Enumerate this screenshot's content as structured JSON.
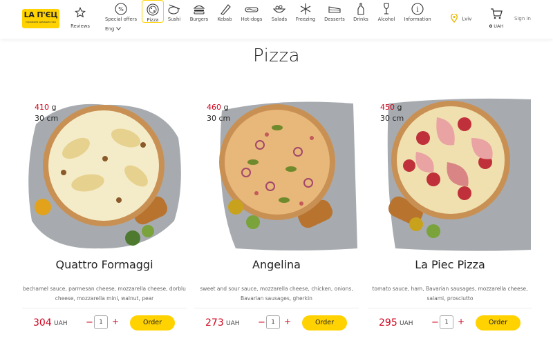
{
  "brand": {
    "logo_text": "LA П'ЄЦ",
    "logo_tagline": "справжня домашня їжа",
    "color": "#ffd200"
  },
  "header": {
    "reviews_label": "Reviews",
    "nav": [
      {
        "label": "Special offers",
        "icon": "percent-icon"
      },
      {
        "label": "Pizza",
        "icon": "pizza-icon",
        "active": true
      },
      {
        "label": "Sushi",
        "icon": "sushi-icon"
      },
      {
        "label": "Burgers",
        "icon": "burger-icon"
      },
      {
        "label": "Kebab",
        "icon": "kebab-icon"
      },
      {
        "label": "Hot-dogs",
        "icon": "hotdog-icon"
      },
      {
        "label": "Salads",
        "icon": "salad-icon"
      },
      {
        "label": "Freezing",
        "icon": "snowflake-icon"
      },
      {
        "label": "Desserts",
        "icon": "cake-icon"
      },
      {
        "label": "Drinks",
        "icon": "bottle-icon"
      },
      {
        "label": "Alcohol",
        "icon": "wine-icon"
      },
      {
        "label": "Information",
        "icon": "info-icon"
      }
    ],
    "language": "Eng",
    "city": "Lviv",
    "cart_amount": "0",
    "cart_currency": "UAH",
    "sign_in": "Sign in"
  },
  "page": {
    "title": "Pizza"
  },
  "products": [
    {
      "weight": "410",
      "weight_unit": "g",
      "size": "30 cm",
      "name": "Quattro Formaggi",
      "description": "bechamel sauce, parmesan cheese, mozzarella cheese, dorblu cheese, mozzarella mini, walnut, pear",
      "price": "304",
      "currency": "UAH",
      "qty": "1",
      "minus": "−",
      "plus": "+",
      "order_label": "Order"
    },
    {
      "weight": "460",
      "weight_unit": "g",
      "size": "30 cm",
      "name": "Angelina",
      "description": "sweet and sour sauce, mozzarella cheese, chicken, onions, Bavarian sausages, gherkin",
      "price": "273",
      "currency": "UAH",
      "qty": "1",
      "minus": "−",
      "plus": "+",
      "order_label": "Order"
    },
    {
      "weight": "450",
      "weight_unit": "g",
      "size": "30 cm",
      "name": "La Piec Pizza",
      "description": "tomato sauce, ham, Bavarian sausages, mozzarella cheese, salami, prosciutto",
      "price": "295",
      "currency": "UAH",
      "qty": "1",
      "minus": "−",
      "plus": "+",
      "order_label": "Order"
    }
  ],
  "colors": {
    "accent": "#ffd200",
    "price": "#d0021b"
  }
}
